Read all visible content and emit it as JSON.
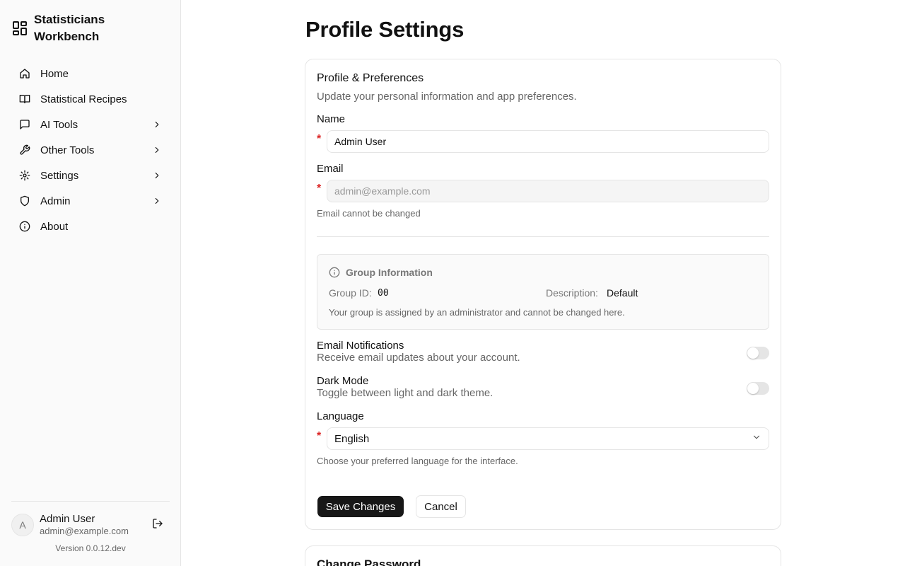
{
  "app": {
    "name": "Statisticians Workbench",
    "version": "Version 0.0.12.dev"
  },
  "sidebar": {
    "items": [
      {
        "label": "Home",
        "icon": "home-icon",
        "has_submenu": false
      },
      {
        "label": "Statistical Recipes",
        "icon": "book-icon",
        "has_submenu": false
      },
      {
        "label": "AI Tools",
        "icon": "message-icon",
        "has_submenu": true
      },
      {
        "label": "Other Tools",
        "icon": "wrench-icon",
        "has_submenu": true
      },
      {
        "label": "Settings",
        "icon": "gear-icon",
        "has_submenu": true
      },
      {
        "label": "Admin",
        "icon": "shield-icon",
        "has_submenu": true
      },
      {
        "label": "About",
        "icon": "info-icon",
        "has_submenu": false
      }
    ],
    "user": {
      "avatar_initial": "A",
      "name": "Admin User",
      "email": "admin@example.com"
    }
  },
  "page": {
    "title": "Profile Settings"
  },
  "profile_card": {
    "title": "Profile & Preferences",
    "description": "Update your personal information and app preferences.",
    "name_label": "Name",
    "name_value": "Admin User",
    "required_marker": "*",
    "email_label": "Email",
    "email_placeholder": "admin@example.com",
    "email_hint": "Email cannot be changed",
    "group": {
      "title": "Group Information",
      "id_label": "Group ID:",
      "id_value": "00",
      "desc_label": "Description:",
      "desc_value": "Default",
      "note": "Your group is assigned by an administrator and cannot be changed here."
    },
    "email_notifications": {
      "title": "Email Notifications",
      "description": "Receive email updates about your account.",
      "enabled": false
    },
    "dark_mode": {
      "title": "Dark Mode",
      "description": "Toggle between light and dark theme.",
      "enabled": false
    },
    "language_label": "Language",
    "language_value": "English",
    "language_hint": "Choose your preferred language for the interface.",
    "save_label": "Save Changes",
    "cancel_label": "Cancel"
  },
  "password_card": {
    "title": "Change Password"
  },
  "colors": {
    "primary": "#171717",
    "required": "#dc2626",
    "border": "#e5e5e5",
    "muted_text": "#666666"
  }
}
